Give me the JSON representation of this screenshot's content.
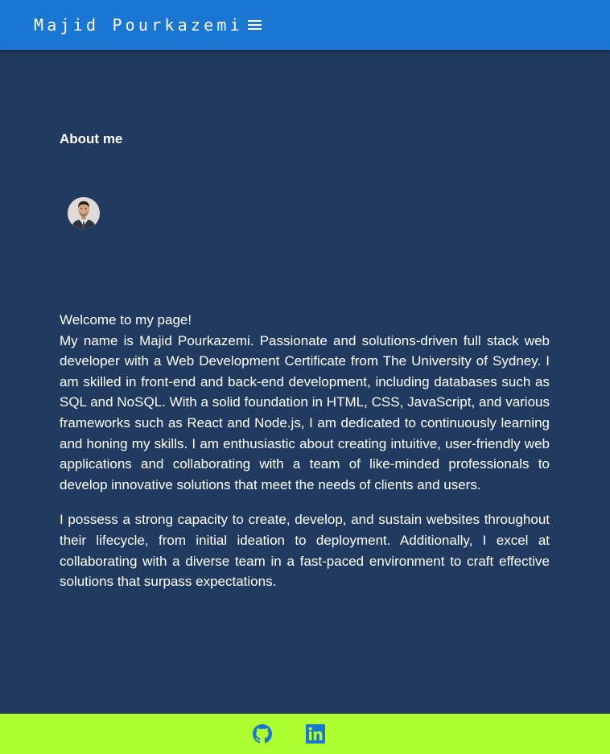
{
  "navbar": {
    "brand": "Majid Pourkazemi",
    "menu_icon": "hamburger-menu-icon"
  },
  "about": {
    "title": "About me",
    "avatar_icon": "profile-photo",
    "greeting": "Welcome to my page!",
    "paragraph1": "My name is Majid Pourkazemi. Passionate and solutions-driven full stack web developer with a Web Development Certificate from The University of Sydney. I am skilled in front-end and back-end development, including databases such as SQL and NoSQL. With a solid foundation in HTML, CSS, JavaScript, and various frameworks such as React and Node.js, I am dedicated to continuously learning and honing my skills. I am enthusiastic about creating intuitive, user-friendly web applications and collaborating with a team of like-minded professionals to develop innovative solutions that meet the needs of clients and users.",
    "paragraph2": "I possess a strong capacity to create, develop, and sustain websites throughout their lifecycle, from initial ideation to deployment. Additionally, I excel at collaborating with a diverse team in a fast-paced environment to craft effective solutions that surpass expectations."
  },
  "footer": {
    "links": [
      {
        "icon": "github-icon"
      },
      {
        "icon": "linkedin-icon"
      }
    ]
  },
  "colors": {
    "navbar": "#1976d2",
    "background": "#213a5f",
    "footer": "#adff2f",
    "social_icon": "#1976d2",
    "text": "#ffffff"
  }
}
